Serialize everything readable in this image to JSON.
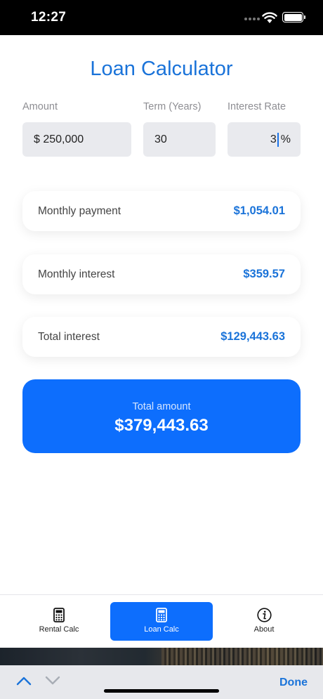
{
  "status_bar": {
    "time": "12:27"
  },
  "page": {
    "title": "Loan Calculator"
  },
  "inputs": {
    "amount": {
      "label": "Amount",
      "value": "$ 250,000"
    },
    "term": {
      "label": "Term (Years)",
      "value": "30"
    },
    "rate": {
      "label": "Interest Rate",
      "value": "3",
      "suffix": "%"
    }
  },
  "results": {
    "monthly_payment": {
      "label": "Monthly payment",
      "value": "$1,054.01"
    },
    "monthly_interest": {
      "label": "Monthly interest",
      "value": "$359.57"
    },
    "total_interest": {
      "label": "Total interest",
      "value": "$129,443.63"
    }
  },
  "total": {
    "label": "Total amount",
    "value": "$379,443.63"
  },
  "tabs": [
    {
      "label": "Rental Calc",
      "icon": "calculator-icon",
      "selected": false
    },
    {
      "label": "Loan Calc",
      "icon": "calculator-icon",
      "selected": true
    },
    {
      "label": "About",
      "icon": "info-icon",
      "selected": false
    }
  ],
  "keyboard_accessory": {
    "done_label": "Done"
  },
  "colors": {
    "accent": "#1a73d9",
    "primary_button": "#0d6efd",
    "field_bg": "#e9eaee"
  }
}
